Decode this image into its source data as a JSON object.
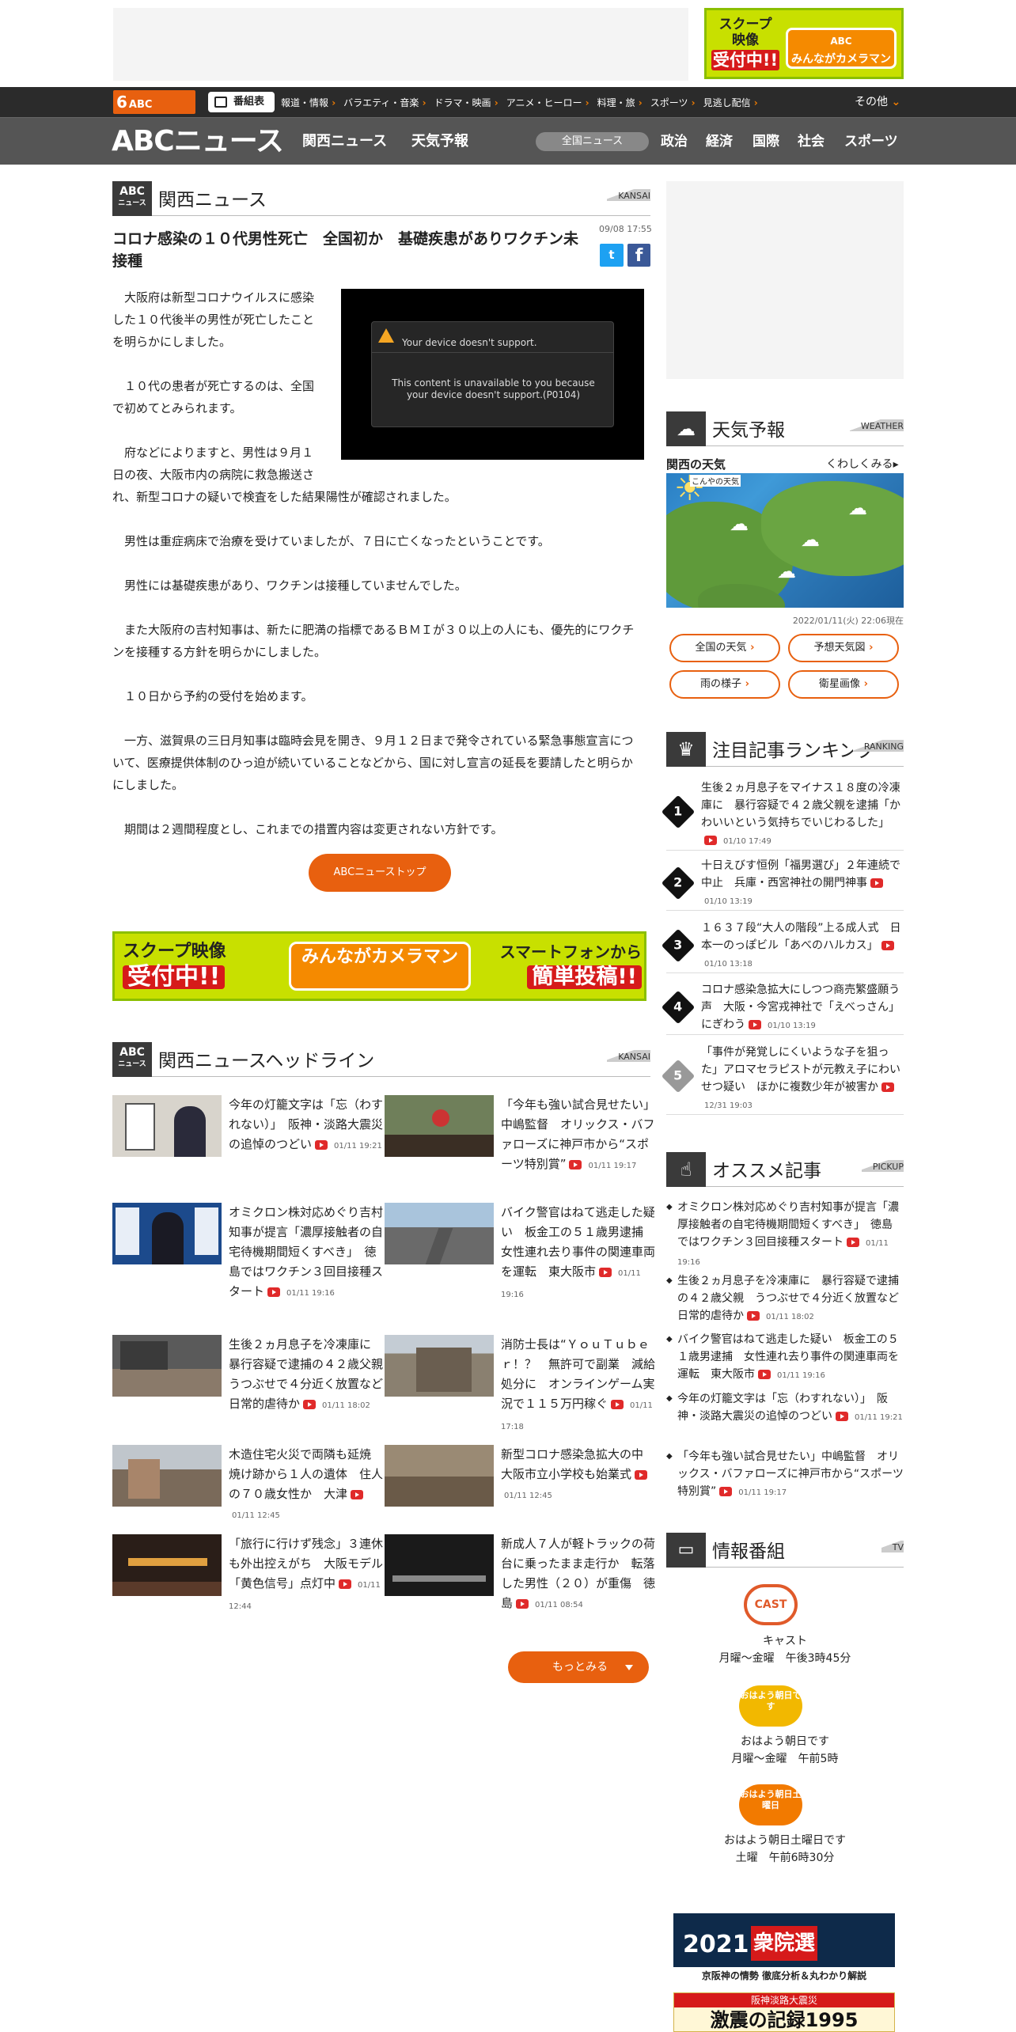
{
  "ads": {
    "scoop_top": {
      "line1": "スクープ",
      "line2": "映像",
      "line3": "受付中!!",
      "brand": "みんながカメラマン",
      "brand_sub": "ABC"
    },
    "scoop_wide": {
      "left1": "スクープ映像",
      "left2": "受付中!!",
      "center": "みんながカメラマン",
      "right1": "スマートフォンから",
      "right2": "簡単投稿!!"
    }
  },
  "nav1": {
    "logo": "6",
    "logo_sub": "ABC",
    "bangumi": "番組表",
    "items": [
      "報道・情報",
      "バラエティ・音楽",
      "ドラマ・映画",
      "アニメ・ヒーロー",
      "料理・旅",
      "スポーツ",
      "見逃し配信"
    ],
    "other": "その他"
  },
  "nav2": {
    "logo": "ABCニュース",
    "links": [
      "関西ニュース",
      "天気予報"
    ],
    "pill": "全国ニュース",
    "cats": [
      "政治",
      "経済",
      "国際",
      "社会",
      "スポーツ"
    ]
  },
  "article": {
    "section_icon": "ABC",
    "section_icon_sub": "ニュース",
    "section": "関西ニュース",
    "section_en": "KANSAI",
    "title": "コロナ感染の１０代男性死亡　全国初か　基礎疾患がありワクチン未接種",
    "date": "09/08 17:55",
    "video_heading": "Your device doesn't support.",
    "video_message": "This content is unavailable to you because your device doesn't support.(P0104)",
    "paragraphs": [
      "大阪府は新型コロナウイルスに感染した１０代後半の男性が死亡したことを明らかにしました。",
      "１０代の患者が死亡するのは、全国で初めてとみられます。",
      "府などによりますと、男性は９月１日の夜、大阪市内の病院に救急搬送され、新型コロナの疑いで検査をした結果陽性が確認されました。",
      "男性は重症病床で治療を受けていましたが、７日に亡くなったということです。",
      "男性には基礎疾患があり、ワクチンは接種していませんでした。",
      "また大阪府の吉村知事は、新たに肥満の指標であるＢＭＩが３０以上の人にも、優先的にワクチンを接種する方針を明らかにしました。",
      "１０日から予約の受付を始めます。",
      "一方、滋賀県の三日月知事は臨時会見を開き、９月１２日まで発令されている緊急事態宣言について、医療提供体制のひっ迫が続いていることなどから、国に対し宣言の延長を要請したと明らかにしました。",
      "期間は２週間程度とし、これまでの措置内容は変更されない方針です。"
    ],
    "top_button": "ABCニューストップ"
  },
  "headlines": {
    "section": "関西ニュースヘッドライン",
    "section_en": "KANSAI",
    "items": [
      {
        "text": "今年の灯籠文字は「忘（わすれない）」　阪神・淡路大震災の追悼のつどい",
        "time": "01/11 19:21"
      },
      {
        "text": "「今年も強い試合見せたい」中嶋監督　オリックス・バファローズに神戸市から“スポーツ特別賞”",
        "time": "01/11 19:17"
      },
      {
        "text": "オミクロン株対応めぐり吉村知事が提言「濃厚接触者の自宅待機期間短くすべき」　徳島ではワクチン３回目接種スタート",
        "time": "01/11 19:16"
      },
      {
        "text": "バイク警官はねて逃走した疑い　板金工の５１歳男逮捕　女性連れ去り事件の関連車両を運転　東大阪市",
        "time": "01/11 19:16"
      },
      {
        "text": "生後２ヵ月息子を冷凍庫に　暴行容疑で逮捕の４２歳父親　うつぶせで４分近く放置など日常的虐待か",
        "time": "01/11 18:02"
      },
      {
        "text": "消防士長は“ＹｏｕＴｕｂｅｒ！？　無許可で副業　減給処分に　オンラインゲーム実況で１１５万円稼ぐ",
        "time": "01/11 17:18"
      },
      {
        "text": "木造住宅火災で両隣も延焼　焼け跡から１人の遺体　住人の７０歳女性か　大津",
        "time": "01/11 12:45"
      },
      {
        "text": "新型コロナ感染急拡大の中　大阪市立小学校も始業式",
        "time": "01/11 12:45"
      },
      {
        "text": "「旅行に行けず残念」３連休も外出控えがち　大阪モデル「黄色信号」点灯中",
        "time": "01/11 12:44"
      },
      {
        "text": "新成人７人が軽トラックの荷台に乗ったまま走行か　転落した男性（２０）が重傷　徳島",
        "time": "01/11 08:54"
      }
    ],
    "more": "もっとみる"
  },
  "weather": {
    "title": "天気予報",
    "en": "WEATHER",
    "area": "関西の天気",
    "more": "くわしくみる",
    "map_label": "こんやの天気",
    "date": "2022/01/11(火) 22:06現在",
    "buttons": [
      "全国の天気",
      "予想天気図",
      "雨の様子",
      "衛星画像"
    ]
  },
  "ranking": {
    "title": "注目記事ランキング",
    "en": "RANKING",
    "items": [
      {
        "rank": "1",
        "text": "生後２ヵ月息子をマイナス１８度の冷凍庫に　暴行容疑で４２歳父親を逮捕「かわいいという気持ちでいじわるした」",
        "time": "01/10 17:49"
      },
      {
        "rank": "2",
        "text": "十日えびす恒例「福男選び」２年連続で中止　兵庫・西宮神社の開門神事",
        "time": "01/10 13:19"
      },
      {
        "rank": "3",
        "text": "１６３７段“大人の階段”上る成人式　日本一のっぽビル「あべのハルカス」",
        "time": "01/10 13:18"
      },
      {
        "rank": "4",
        "text": "コロナ感染急拡大にしつつ商売繁盛願う声　大阪・今宮戎神社で「えべっさん」にぎわう",
        "time": "01/10 13:19"
      },
      {
        "rank": "5",
        "text": "「事件が発覚しにくいような子を狙った」アロマセラピストが元教え子にわいせつ疑い　ほかに複数少年が被害か",
        "time": "12/31 19:03"
      }
    ]
  },
  "pickup": {
    "title": "オススメ記事",
    "en": "PICKUP",
    "items": [
      {
        "text": "オミクロン株対応めぐり吉村知事が提言「濃厚接触者の自宅待機期間短くすべき」　徳島ではワクチン３回目接種スタート",
        "time": "01/11 19:16"
      },
      {
        "text": "生後２ヵ月息子を冷凍庫に　暴行容疑で逮捕の４２歳父親　うつぶせで４分近く放置など日常的虐待か",
        "time": "01/11 18:02"
      },
      {
        "text": "バイク警官はねて逃走した疑い　板金工の５１歳男逮捕　女性連れ去り事件の関連車両を運転　東大阪市",
        "time": "01/11 19:16"
      },
      {
        "text": "今年の灯籠文字は「忘（わすれない）」　阪神・淡路大震災の追悼のつどい",
        "time": "01/11 19:21"
      },
      {
        "text": "「今年も強い試合見せたい」中嶋監督　オリックス・バファローズに神戸市から“スポーツ特別賞”",
        "time": "01/11 19:17"
      }
    ]
  },
  "programs": {
    "title": "情報番組",
    "en": "TV",
    "items": [
      {
        "logo": "CAST",
        "name": "キャスト",
        "time": "月曜～金曜　午後3時45分"
      },
      {
        "logo": "おはよう朝日です",
        "name": "おはよう朝日です",
        "time": "月曜～金曜　午前5時"
      },
      {
        "logo": "おはよう朝日土曜日",
        "name": "おはよう朝日土曜日です",
        "time": "土曜　午前6時30分"
      }
    ]
  },
  "bottom_ads": {
    "election_year": "2021",
    "election": "衆院選",
    "election_sub": "京阪神の情勢 徹底分析＆丸わかり解説",
    "quake_top": "阪神淡路大震災",
    "quake_main": "激震の記録1995"
  },
  "colors": {
    "accent": "#e8600f",
    "nav_dark": "#2b2b2b",
    "nav_gray": "#555555",
    "twitter": "#1da1f2",
    "facebook": "#3b5998"
  }
}
